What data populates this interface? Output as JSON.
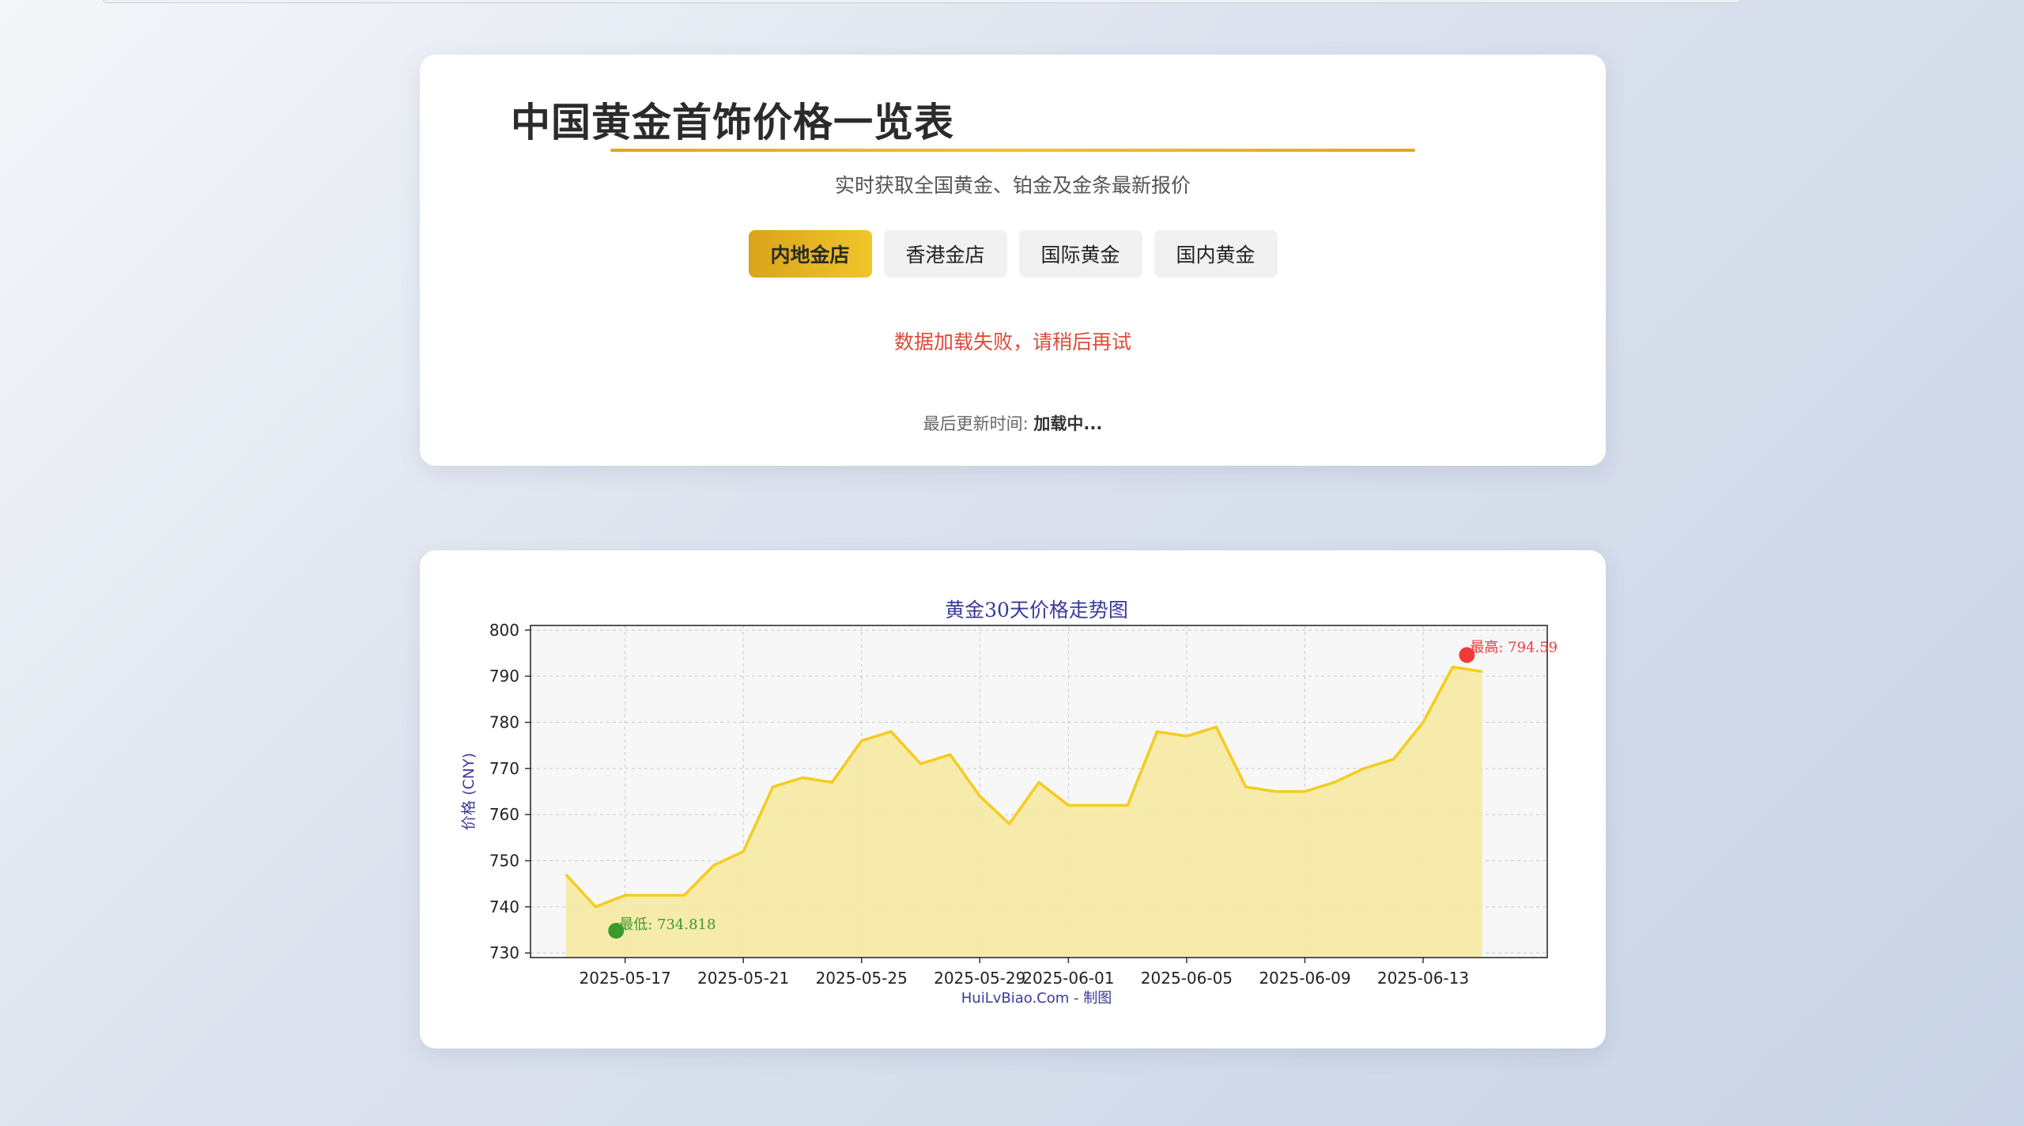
{
  "header": {
    "title": "中国黄金首饰价格一览表",
    "subtitle": "实时获取全国黄金、铂金及金条最新报价"
  },
  "tabs": [
    {
      "label": "内地金店",
      "active": true
    },
    {
      "label": "香港金店",
      "active": false
    },
    {
      "label": "国际黄金",
      "active": false
    },
    {
      "label": "国内黄金",
      "active": false
    }
  ],
  "status": {
    "error_message": "数据加载失败，请稍后再试",
    "update_label": "最后更新时间:",
    "update_value": "加载中..."
  },
  "colors": {
    "accent": "#e8b51f",
    "line": "#f5cc1e",
    "fill": "#f7eaa6",
    "error": "#e04a3a",
    "max_marker": "#f03a3a",
    "min_marker": "#3a9a2a",
    "chart_text": "#3a3a9a"
  },
  "chart_data": {
    "type": "area",
    "title": "黄金30天价格走势图",
    "ylabel": "价格 (CNY)",
    "xlabel": "HuiLvBiao.Com - 制图",
    "ylim": [
      729,
      801
    ],
    "yticks": [
      730,
      740,
      750,
      760,
      770,
      780,
      790,
      800
    ],
    "xticks": [
      "2025-05-17",
      "2025-05-21",
      "2025-05-25",
      "2025-05-29",
      "2025-06-01",
      "2025-06-05",
      "2025-06-09",
      "2025-06-13"
    ],
    "grid": true,
    "max_annotation": "最高: 794.59",
    "min_annotation": "最低: 734.818",
    "max": 794.59,
    "min": 734.818,
    "x": [
      "2025-05-15",
      "2025-05-16",
      "2025-05-17",
      "2025-05-18",
      "2025-05-19",
      "2025-05-20",
      "2025-05-21",
      "2025-05-22",
      "2025-05-23",
      "2025-05-24",
      "2025-05-25",
      "2025-05-26",
      "2025-05-27",
      "2025-05-28",
      "2025-05-29",
      "2025-05-30",
      "2025-05-31",
      "2025-06-01",
      "2025-06-02",
      "2025-06-03",
      "2025-06-04",
      "2025-06-05",
      "2025-06-06",
      "2025-06-07",
      "2025-06-08",
      "2025-06-09",
      "2025-06-10",
      "2025-06-11",
      "2025-06-12",
      "2025-06-13",
      "2025-06-14",
      "2025-06-15"
    ],
    "values": [
      747,
      740,
      742.5,
      742.5,
      742.5,
      749,
      752,
      766,
      768,
      767,
      776,
      778,
      771,
      773,
      764,
      758,
      767,
      762,
      762,
      762,
      778,
      777,
      779,
      766,
      765,
      765,
      767,
      770,
      772,
      780,
      792,
      791
    ]
  }
}
